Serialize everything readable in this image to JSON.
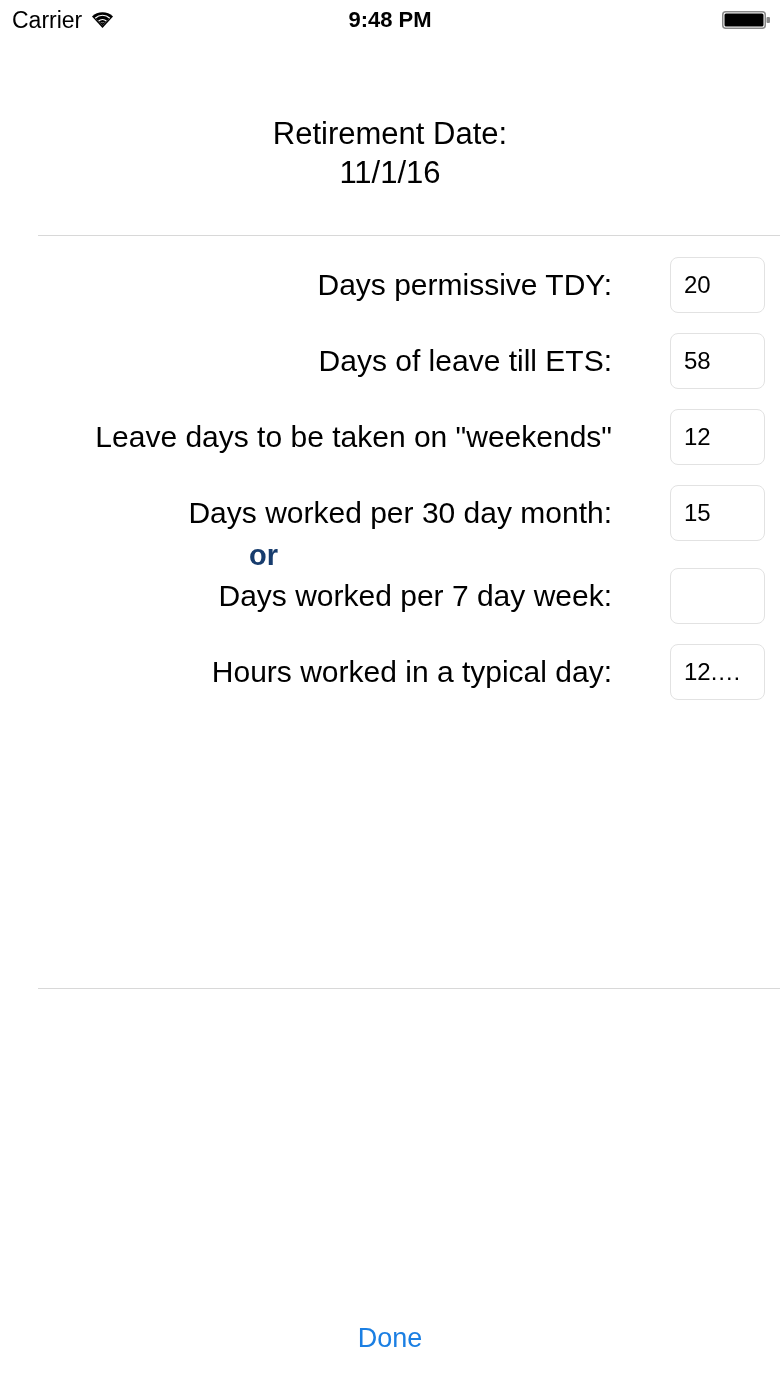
{
  "status_bar": {
    "carrier": "Carrier",
    "time": "9:48 PM"
  },
  "header": {
    "label": "Retirement Date:",
    "date": "11/1/16"
  },
  "form": {
    "rows": [
      {
        "kind": "field",
        "label": "Days permissive TDY:",
        "value": "20"
      },
      {
        "kind": "field",
        "label": "Days of leave till ETS:",
        "value": "58"
      },
      {
        "kind": "field",
        "label": "Leave days to be taken on \"weekends\"",
        "value": "12"
      },
      {
        "kind": "field",
        "label": "Days worked per 30 day month:",
        "value": "15"
      },
      {
        "kind": "conjunction",
        "text": "or"
      },
      {
        "kind": "field",
        "label": "Days worked per 7 day week:"
      },
      {
        "kind": "field",
        "label": "Hours worked in a typical day:",
        "value": "12.…"
      }
    ]
  },
  "done_button": {
    "label": "Done"
  }
}
